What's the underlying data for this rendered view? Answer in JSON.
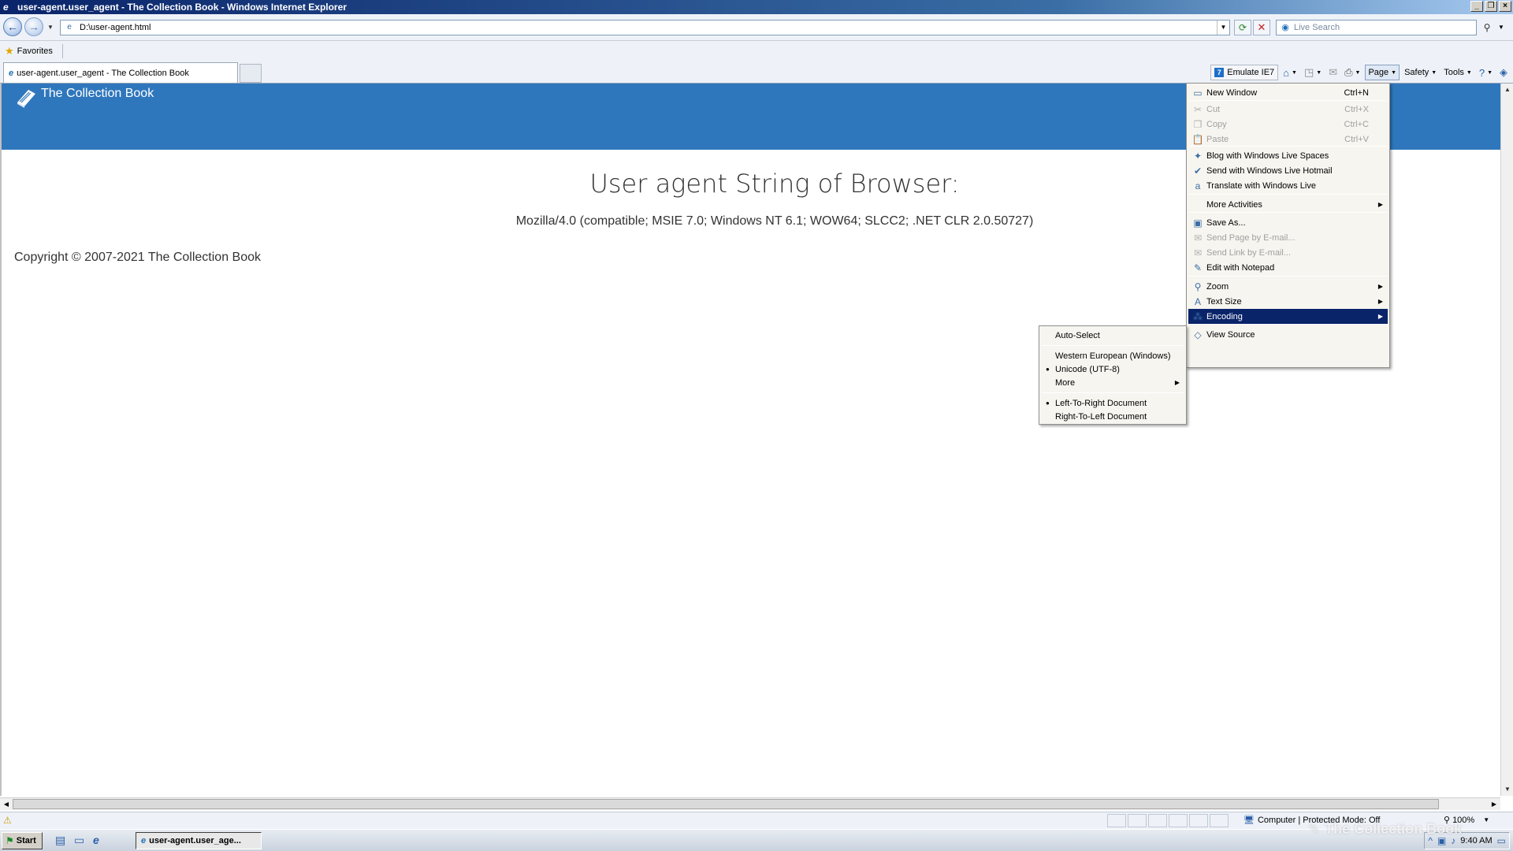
{
  "window": {
    "title": "user-agent.user_agent - The Collection Book - Windows Internet Explorer"
  },
  "address": {
    "url": "D:\\user-agent.html",
    "search_placeholder": "Live Search"
  },
  "favorites": {
    "label": "Favorites"
  },
  "tab": {
    "title": "user-agent.user_agent - The Collection Book"
  },
  "command_bar": {
    "emulate": "Emulate IE7",
    "page": "Page",
    "safety": "Safety",
    "tools": "Tools"
  },
  "page": {
    "brand": "The Collection Book",
    "heading": "User agent String of Browser:",
    "ua_string": "Mozilla/4.0 (compatible; MSIE 7.0; Windows NT 6.1; WOW64; SLCC2; .NET CLR 2.0.50727)",
    "copyright": "Copyright © 2007-2021 The Collection Book"
  },
  "page_menu": {
    "items": [
      {
        "label": "New Window",
        "shortcut": "Ctrl+N",
        "icon": "window-icon"
      },
      {
        "label": "Cut",
        "shortcut": "Ctrl+X",
        "icon": "cut-icon",
        "disabled": true
      },
      {
        "label": "Copy",
        "shortcut": "Ctrl+C",
        "icon": "copy-icon",
        "disabled": true
      },
      {
        "label": "Paste",
        "shortcut": "Ctrl+V",
        "icon": "paste-icon",
        "disabled": true
      },
      {
        "label": "Blog with Windows Live Spaces",
        "icon": "windows-live-spaces-icon"
      },
      {
        "label": "Send with Windows Live Hotmail",
        "icon": "hotmail-icon"
      },
      {
        "label": "Translate with Windows Live",
        "icon": "translate-icon"
      },
      {
        "label": "More Activities",
        "icon": "",
        "submenu": true
      },
      {
        "label": "Save As...",
        "icon": "save-icon"
      },
      {
        "label": "Send Page by E-mail...",
        "icon": "email-page-icon",
        "disabled": true
      },
      {
        "label": "Send Link by E-mail...",
        "icon": "email-link-icon",
        "disabled": true
      },
      {
        "label": "Edit with Notepad",
        "icon": "edit-icon"
      },
      {
        "label": "Zoom",
        "icon": "zoom-icon",
        "submenu": true
      },
      {
        "label": "Text Size",
        "icon": "text-size-icon",
        "submenu": true
      },
      {
        "label": "Encoding",
        "icon": "encoding-icon",
        "submenu": true,
        "highlighted": true
      },
      {
        "label": "View Source",
        "icon": "view-source-icon"
      }
    ]
  },
  "encoding_menu": {
    "items": [
      {
        "label": "Auto-Select"
      },
      {
        "label": "Western European (Windows)"
      },
      {
        "label": "Unicode (UTF-8)",
        "selected": true
      },
      {
        "label": "More",
        "submenu": true
      },
      {
        "label": "Left-To-Right Document",
        "selected": true
      },
      {
        "label": "Right-To-Left Document"
      }
    ]
  },
  "status": {
    "zone": "Computer | Protected Mode: Off",
    "zoom": "100%"
  },
  "taskbar": {
    "start": "Start",
    "task": "user-agent.user_age...",
    "time": "9:40 AM"
  },
  "watermark": "The Collection Book"
}
